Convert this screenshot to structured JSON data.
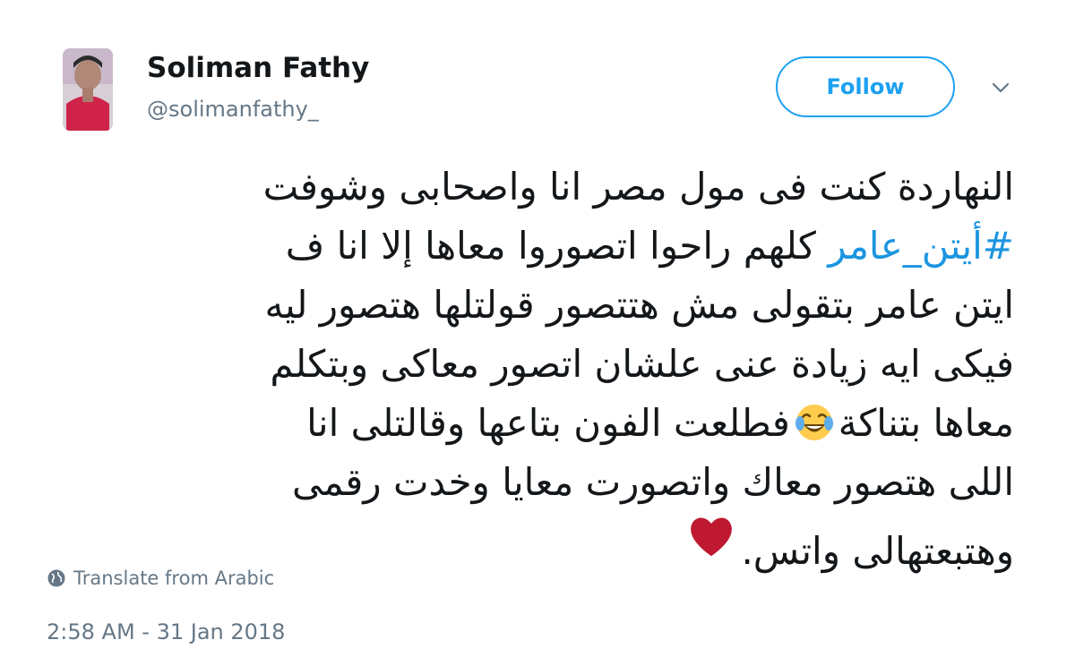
{
  "author": {
    "name": "Soliman Fathy",
    "handle": "@solimanfathy_",
    "avatar_icon": "profile-photo"
  },
  "follow_button": {
    "label": "Follow",
    "color": "#1da1f2"
  },
  "menu_icon": "chevron-down-icon",
  "tweet": {
    "lines": [
      "النهاردة كنت فى مول مصر انا واصحابى وشوفت",
      "كلهم راحوا اتصوروا معاها إلا انا ف",
      "ايتن عامر بتقولى مش هتتصور قولتلها هتصور ليه",
      "فيكى ايه زيادة عنى علشان اتصور معاكى وبتكلم",
      "فطلعت الفون بتاعها وقالتلى انا",
      "اللى هتصور معاك واتصورت معايا وخدت رقمى",
      "وهتبعتهالى واتس."
    ],
    "hashtag": "#أيتن_عامر",
    "line5_prefix": "معاها بتناكة",
    "hashtag_color": "#1b95e0",
    "emojis": [
      "face-with-tears-of-joy",
      "red-heart"
    ]
  },
  "translate": {
    "label": "Translate from Arabic",
    "icon": "globe-icon"
  },
  "timestamp": "2:58 AM - 31 Jan 2018",
  "colors": {
    "text": "#14171a",
    "secondary": "#657786",
    "accent": "#1da1f2"
  }
}
